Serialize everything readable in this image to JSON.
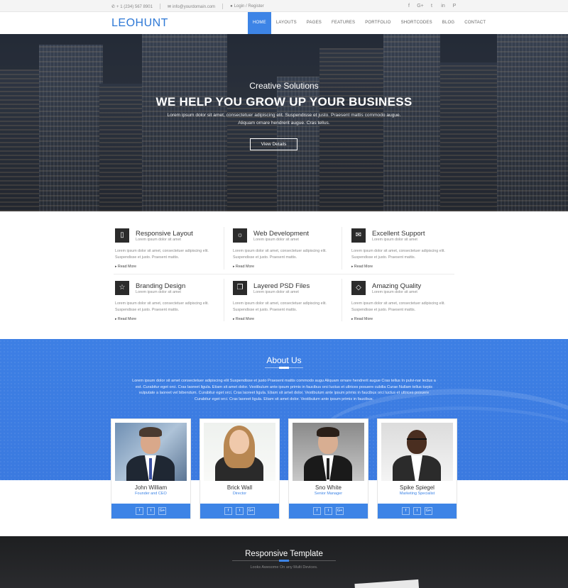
{
  "topbar": {
    "phone": "+ 1 (234) 567 8901",
    "email": "info@yourdomain.com",
    "login": "Login / Register",
    "social": [
      "f",
      "G+",
      "t",
      "in",
      "P"
    ]
  },
  "header": {
    "logo": "LEOHUNT",
    "nav": [
      "HOME",
      "LAYOUTS",
      "PAGES",
      "FEATURES",
      "PORTFOLIO",
      "SHORTCODES",
      "BLOG",
      "CONTACT"
    ]
  },
  "hero": {
    "subtitle": "Creative Solutions",
    "title": "WE HELP YOU GROW UP YOUR BUSINESS",
    "description": "Lorem ipsum dolor sit amet, consectetuer adipiscing elit. Suspendisse et justo. Praesent mattis commodo augue. Aliquam ornare hendrerit augue. Cras tellus.",
    "button": "View Details"
  },
  "features": [
    {
      "icon": "mobile-icon",
      "glyph": "▯",
      "title": "Responsive Layout",
      "sub": "Lorem ipsum dolor sit amet",
      "desc": "Lorem ipsum dolor sit amet, consectetuer adipiscing elit. Suspendisse et justo. Praesent mattis.",
      "more": "Read More"
    },
    {
      "icon": "lightbulb-icon",
      "glyph": "♀",
      "title": "Web Development",
      "sub": "Lorem ipsum dolor sit amet",
      "desc": "Lorem ipsum dolor sit amet, consectetuer adipiscing elit. Suspendisse et justo. Praesent mattis.",
      "more": "Read More"
    },
    {
      "icon": "chat-icon",
      "glyph": "☁",
      "title": "Excellent Support",
      "sub": "Lorem ipsum dolor sit amet",
      "desc": "Lorem ipsum dolor sit amet, consectetuer adipiscing elit. Suspendisse et justo. Praesent mattis.",
      "more": "Read More"
    },
    {
      "icon": "star-icon",
      "glyph": "☆",
      "title": "Branding Design",
      "sub": "Lorem ipsum dolor sit amet",
      "desc": "Lorem ipsum dolor sit amet, consectetuer adipiscing elit. Suspendisse et justo. Praesent mattis.",
      "more": "Read More"
    },
    {
      "icon": "layers-icon",
      "glyph": "❐",
      "title": "Layered PSD Files",
      "sub": "Lorem ipsum dolor sit amet",
      "desc": "Lorem ipsum dolor sit amet, consectetuer adipiscing elit. Suspendisse et justo. Praesent mattis.",
      "more": "Read More"
    },
    {
      "icon": "diamond-icon",
      "glyph": "◇",
      "title": "Amazing Quality",
      "sub": "Lorem ipsum dolor sit amet",
      "desc": "Lorem ipsum dolor sit amet, consectetuer adipiscing elit. Suspendisse et justo. Praesent mattis.",
      "more": "Read More"
    }
  ],
  "about": {
    "title": "About Us",
    "description": "Lorem ipsum dolor sit amet consectetuer adipiscing elit Suspendisse et justo Praesent mattis commodo augu Aliquam ornare hendrerit augue Cras tellus In pulvi-nar lectus a est. Curabitur eget orci. Cras laoreet ligula. Etiam sit amet dolor. Vestibulum ante ipsum primis in faucibus orci luctus et ultrices posuere cubilia Curae Nullam tellus turpis vulputate a laoreet vel bibendum. Curabitur eget orci. Cras laoreet ligula. Etiam sit amet dolor. Vestibulum ante ipsum primis in faucibus orci luctus et ultrices posuere Curabitur eget orci. Cras laoreet ligula. Etiam sit amet dolor. Vestibulum ante ipsum primis in faucibus.",
    "team": [
      {
        "name": "John William",
        "role": "Founder and CEO",
        "social": [
          "f",
          "t",
          "G+"
        ]
      },
      {
        "name": "Brick Wall",
        "role": "Director",
        "social": [
          "f",
          "t",
          "G+"
        ]
      },
      {
        "name": "Sno White",
        "role": "Senior Manager",
        "social": [
          "f",
          "t",
          "G+"
        ]
      },
      {
        "name": "Spike Spiegel",
        "role": "Marketing Specialist",
        "social": [
          "f",
          "t",
          "G+"
        ]
      }
    ]
  },
  "template": {
    "title": "Responsive Template",
    "subtitle": "Looks Awesome On any Multi Devices."
  },
  "colors": {
    "accent": "#3d84e6",
    "dark": "#2b2b2b"
  }
}
